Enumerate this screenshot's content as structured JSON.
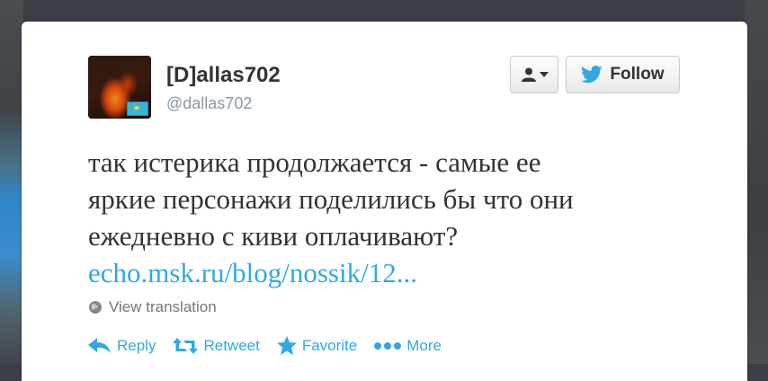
{
  "tweet": {
    "display_name": "[D]allas702",
    "username": "@dallas702",
    "text_lines": [
      "так истерика продолжается - самые ее",
      "яркие персонажи поделились бы что они",
      "ежедневно с киви оплачивают?"
    ],
    "link": "echo.msk.ru/blog/nossik/12...",
    "view_translation": "View translation"
  },
  "buttons": {
    "follow_label": "Follow",
    "user_menu_icon": "user-dropdown-icon"
  },
  "actions": {
    "reply": "Reply",
    "retweet": "Retweet",
    "favorite": "Favorite",
    "more": "More"
  },
  "colors": {
    "link": "#2fa9e0",
    "text": "#333333",
    "muted": "#8899a6"
  }
}
